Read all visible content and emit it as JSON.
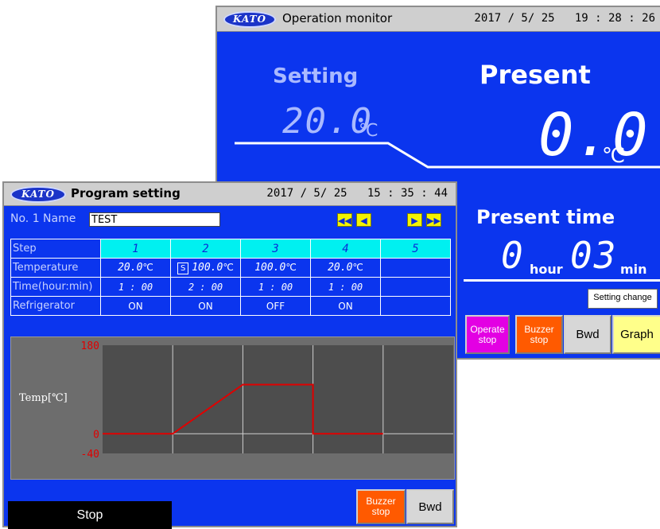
{
  "monitor": {
    "logo": "KATO",
    "title": "Operation monitor",
    "datetime": "2017 / 5/ 25   19 : 28 : 26",
    "setting_label": "Setting",
    "setting_value": "20.0",
    "setting_unit": "℃",
    "present_label": "Present",
    "present_value": "0.0",
    "present_unit": "℃",
    "present_time_label": "Present time",
    "hours": "0",
    "hour_unit": "hour",
    "minutes": "03",
    "min_unit": "min",
    "setting_change": "Setting change",
    "buttons": {
      "operate_stop_1": "Operate",
      "operate_stop_2": "stop",
      "buzzer_stop_1": "Buzzer",
      "buzzer_stop_2": "stop",
      "bwd": "Bwd",
      "graph": "Graph"
    }
  },
  "program": {
    "logo": "KATO",
    "title": "Program setting",
    "datetime": "2017 / 5/ 25   15 : 35 : 44",
    "no_name": "No. 1 Name",
    "name_value": "TEST",
    "nav": {
      "first": "◀◀",
      "prev": "◀",
      "next": "▶",
      "last": "▶▶"
    },
    "row_labels": [
      "Step",
      "Temperature",
      "Time(hour:min)",
      "Refrigerator"
    ],
    "steps": [
      {
        "num": "1",
        "temp": "20.0",
        "temp_unit": "℃",
        "s": "",
        "time": "1 : 00",
        "refrig": "ON"
      },
      {
        "num": "2",
        "temp": "100.0",
        "temp_unit": "℃",
        "s": "S",
        "time": "2 : 00",
        "refrig": "ON"
      },
      {
        "num": "3",
        "temp": "100.0",
        "temp_unit": "℃",
        "s": "",
        "time": "1 : 00",
        "refrig": "OFF"
      },
      {
        "num": "4",
        "temp": "20.0",
        "temp_unit": "℃",
        "s": "",
        "time": "1 : 00",
        "refrig": "ON"
      },
      {
        "num": "5",
        "temp": "",
        "temp_unit": "",
        "s": "",
        "time": "",
        "refrig": ""
      }
    ],
    "stop_label": "Stop",
    "buttons": {
      "buzzer_stop_1": "Buzzer",
      "buzzer_stop_2": "stop",
      "bwd": "Bwd"
    }
  },
  "chart_data": {
    "type": "line",
    "ylabel": "Temp[℃]",
    "ylim": [
      -40,
      180
    ],
    "yticks": [
      "180",
      "0",
      "-40"
    ],
    "yticks_values": [
      180,
      0,
      -40
    ],
    "x_segments": 5,
    "series": [
      {
        "x": [
          0,
          1,
          2,
          3,
          3,
          4
        ],
        "y": [
          0,
          0,
          100,
          100,
          0,
          0
        ]
      }
    ],
    "line_color": "#e00000",
    "grid": true
  }
}
